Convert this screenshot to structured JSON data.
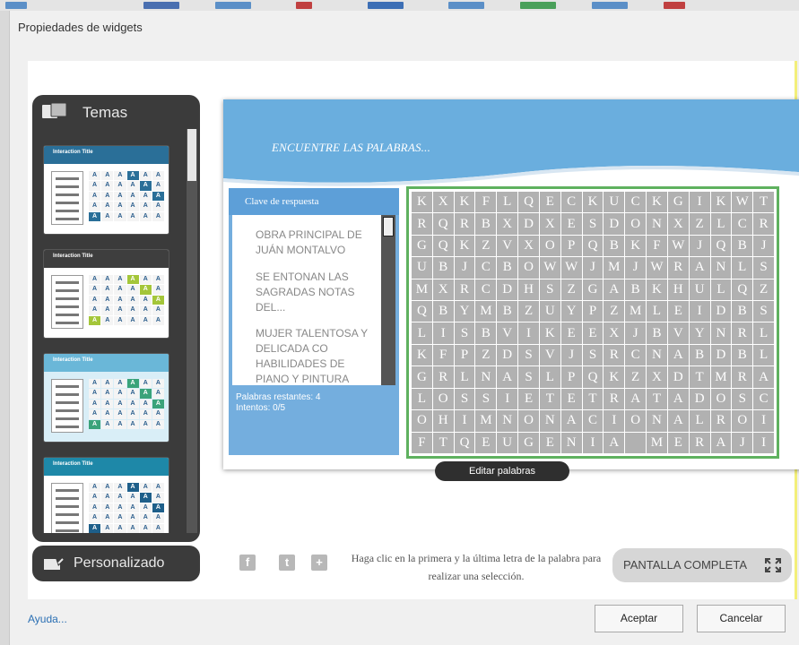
{
  "dialog": {
    "title": "Propiedades de widgets",
    "help_link": "Ayuda...",
    "ok_button": "Aceptar",
    "cancel_button": "Cancelar"
  },
  "themes": {
    "label": "Temas",
    "cards": [
      {
        "title": "Interaction Title",
        "head_color": "#2a6f98",
        "body_color": "#ffffff",
        "accent": "#2a6f98"
      },
      {
        "title": "Interaction Title",
        "head_color": "#3e3e3e",
        "body_color": "#ffffff",
        "accent": "#a4c639"
      },
      {
        "title": "Interaction Title",
        "head_color": "#6ab7d8",
        "body_color": "#d9eef7",
        "accent": "#3aa37a"
      },
      {
        "title": "Interaction Title",
        "head_color": "#1e88a8",
        "body_color": "#ffffff",
        "accent": "#1e5f8a"
      }
    ],
    "custom_label": "Personalizado"
  },
  "widget": {
    "title": "ENCUENTRE LAS PALABRAS...",
    "answer_key_title": "Clave de respuesta",
    "clues": [
      "OBRA PRINCIPAL DE JUÁN MONTALVO",
      "SE ENTONAN LAS SAGRADAS NOTAS DEL...",
      "MUJER TALENTOSA Y DELICADA CO HABILIDADES DE PIANO Y PINTURA"
    ],
    "remaining_words": "Palabras restantes: 4",
    "attempts": "Intentos: 0/5",
    "edit_words_button": "Editar palabras",
    "instruction": "Haga clic en la primera y la última letra de la palabra para realizar una selección.",
    "fullscreen_button": "PANTALLA COMPLETA",
    "grid": [
      "KXKFLQECKUCKGIKWT",
      "RQRBXDXESDONXZLCR",
      "GQKZVXOPQBKFWJQBJ",
      "UBJCBOWWJMJWRANLS",
      "MXRCDHSZGABKHULQZ",
      "QBYMBZUYPZMLEIDBS",
      "LISBVIKEEXJBVYNRL",
      "KFPZDSVJSRCNABDBL",
      "GRLNASLPQKZXDTMRA",
      "LOSSIETETRATADOSC",
      "OHIMNONACIONALROI",
      "FTQEUGENIA MERAJI"
    ],
    "colors": {
      "header_blue": "#6aaede",
      "grid_border": "#5fb15f",
      "cell_gray": "#b1b1b1"
    }
  },
  "social": [
    {
      "icon": "facebook-icon",
      "glyph": "f"
    },
    {
      "icon": "twitter-icon",
      "glyph": "t"
    },
    {
      "icon": "google-plus-icon",
      "glyph": "+"
    }
  ]
}
